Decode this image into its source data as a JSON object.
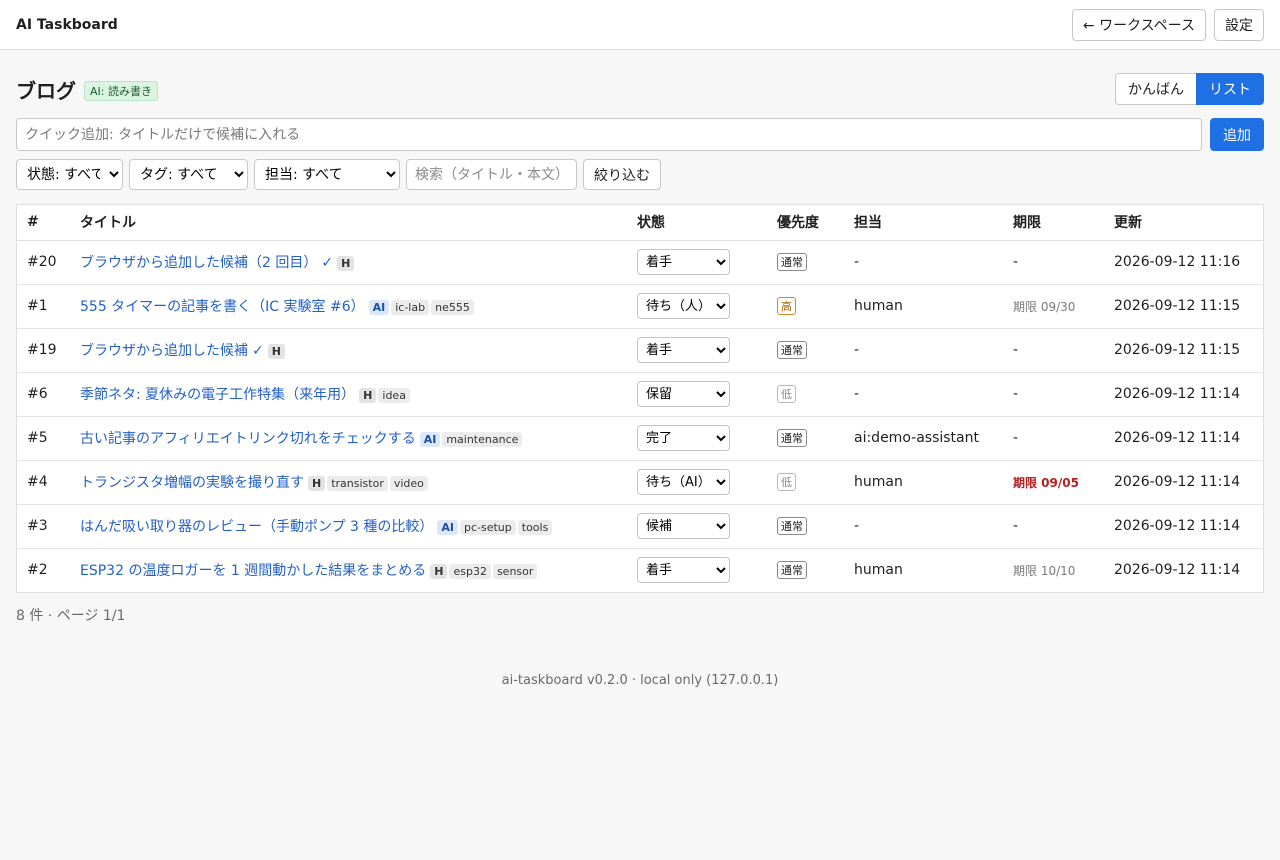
{
  "app": {
    "title": "AI Taskboard"
  },
  "topbar": {
    "back_label": "← ワークスペース",
    "settings_label": "設定"
  },
  "page": {
    "title": "ブログ",
    "ai_badge": "AI: 読み書き"
  },
  "view_toggle": {
    "kanban_label": "かんばん",
    "list_label": "リスト",
    "active": "list"
  },
  "quick_add": {
    "placeholder": "クイック追加: タイトルだけで候補に入れる",
    "button_label": "追加"
  },
  "filters": {
    "status": "状態: すべて",
    "tag": "タグ: すべて",
    "owner": "担当: すべて",
    "search_placeholder": "検索（タイトル・本文）",
    "apply_label": "絞り込む"
  },
  "table": {
    "headers": {
      "num": "#",
      "title": "タイトル",
      "status": "状態",
      "priority": "優先度",
      "owner": "担当",
      "due": "期限",
      "updated": "更新"
    },
    "rows": [
      {
        "num": "#20",
        "title": "ブラウザから追加した候補（2 回目）",
        "check": "✓",
        "ai": "",
        "h": "H",
        "tags": [],
        "status": "着手",
        "priority": "通常",
        "priority_level": "normal",
        "owner": "-",
        "due": "-",
        "due_style": "plain",
        "updated": "2026-09-12 11:16"
      },
      {
        "num": "#1",
        "title": "555 タイマーの記事を書く（IC 実験室 #6）",
        "check": "",
        "ai": "AI",
        "h": "",
        "tags": [
          "ic-lab",
          "ne555"
        ],
        "status": "待ち（人）",
        "priority": "高",
        "priority_level": "high",
        "owner": "human",
        "due": "期限 09/30",
        "due_style": "muted",
        "updated": "2026-09-12 11:15"
      },
      {
        "num": "#19",
        "title": "ブラウザから追加した候補",
        "check": "✓",
        "ai": "",
        "h": "H",
        "tags": [],
        "status": "着手",
        "priority": "通常",
        "priority_level": "normal",
        "owner": "-",
        "due": "-",
        "due_style": "plain",
        "updated": "2026-09-12 11:15"
      },
      {
        "num": "#6",
        "title": "季節ネタ: 夏休みの電子工作特集（来年用）",
        "check": "",
        "ai": "",
        "h": "H",
        "tags": [
          "idea"
        ],
        "status": "保留",
        "priority": "低",
        "priority_level": "low",
        "owner": "-",
        "due": "-",
        "due_style": "plain",
        "updated": "2026-09-12 11:14"
      },
      {
        "num": "#5",
        "title": "古い記事のアフィリエイトリンク切れをチェックする",
        "check": "",
        "ai": "AI",
        "h": "",
        "tags": [
          "maintenance"
        ],
        "status": "完了",
        "priority": "通常",
        "priority_level": "normal",
        "owner": "ai:demo-assistant",
        "due": "-",
        "due_style": "plain",
        "updated": "2026-09-12 11:14"
      },
      {
        "num": "#4",
        "title": "トランジスタ増幅の実験を撮り直す",
        "check": "",
        "ai": "",
        "h": "H",
        "tags": [
          "transistor",
          "video"
        ],
        "status": "待ち（AI）",
        "priority": "低",
        "priority_level": "low",
        "owner": "human",
        "due": "期限 09/05",
        "due_style": "overdue",
        "updated": "2026-09-12 11:14"
      },
      {
        "num": "#3",
        "title": "はんだ吸い取り器のレビュー（手動ポンプ 3 種の比較）",
        "check": "",
        "ai": "AI",
        "h": "",
        "tags": [
          "pc-setup",
          "tools"
        ],
        "status": "候補",
        "priority": "通常",
        "priority_level": "normal",
        "owner": "-",
        "due": "-",
        "due_style": "plain",
        "updated": "2026-09-12 11:14"
      },
      {
        "num": "#2",
        "title": "ESP32 の温度ロガーを 1 週間動かした結果をまとめる",
        "check": "",
        "ai": "",
        "h": "H",
        "tags": [
          "esp32",
          "sensor"
        ],
        "status": "着手",
        "priority": "通常",
        "priority_level": "normal",
        "owner": "human",
        "due": "期限 10/10",
        "due_style": "muted",
        "updated": "2026-09-12 11:14"
      }
    ]
  },
  "pager": {
    "text": "8 件 · ページ 1/1"
  },
  "footer": {
    "text": "ai-taskboard v0.2.0 · local only (127.0.0.1)"
  }
}
